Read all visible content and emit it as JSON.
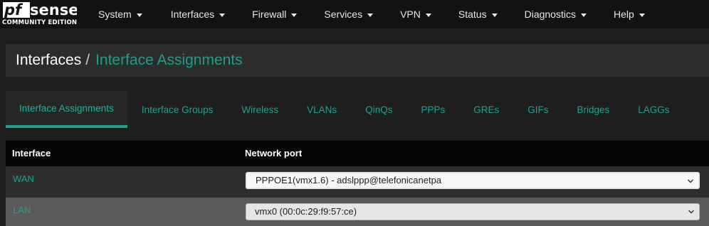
{
  "brand": {
    "logo_text": "pfsense",
    "subtitle": "COMMUNITY EDITION"
  },
  "nav": {
    "items": [
      {
        "label": "System"
      },
      {
        "label": "Interfaces"
      },
      {
        "label": "Firewall"
      },
      {
        "label": "Services"
      },
      {
        "label": "VPN"
      },
      {
        "label": "Status"
      },
      {
        "label": "Diagnostics"
      },
      {
        "label": "Help"
      }
    ]
  },
  "header": {
    "root": "Interfaces",
    "separator": "/",
    "current": "Interface Assignments"
  },
  "tabs": [
    {
      "label": "Interface Assignments",
      "active": true
    },
    {
      "label": "Interface Groups"
    },
    {
      "label": "Wireless"
    },
    {
      "label": "VLANs"
    },
    {
      "label": "QinQs"
    },
    {
      "label": "PPPs"
    },
    {
      "label": "GREs"
    },
    {
      "label": "GIFs"
    },
    {
      "label": "Bridges"
    },
    {
      "label": "LAGGs"
    }
  ],
  "table": {
    "columns": [
      "Interface",
      "Network port"
    ],
    "rows": [
      {
        "interface": "WAN",
        "port": "PPPOE1(vmx1.6) - adslppp@telefonicanetpa"
      },
      {
        "interface": "LAN",
        "port": "vmx0 (00:0c:29:f9:57:ce)"
      }
    ]
  },
  "colors": {
    "accent": "#1ea28f",
    "navbar": "#121212",
    "background": "#1e1e1e"
  },
  "icons": {
    "menu_caret": "caret-down-icon",
    "select_chevron": "chevron-down-icon"
  }
}
